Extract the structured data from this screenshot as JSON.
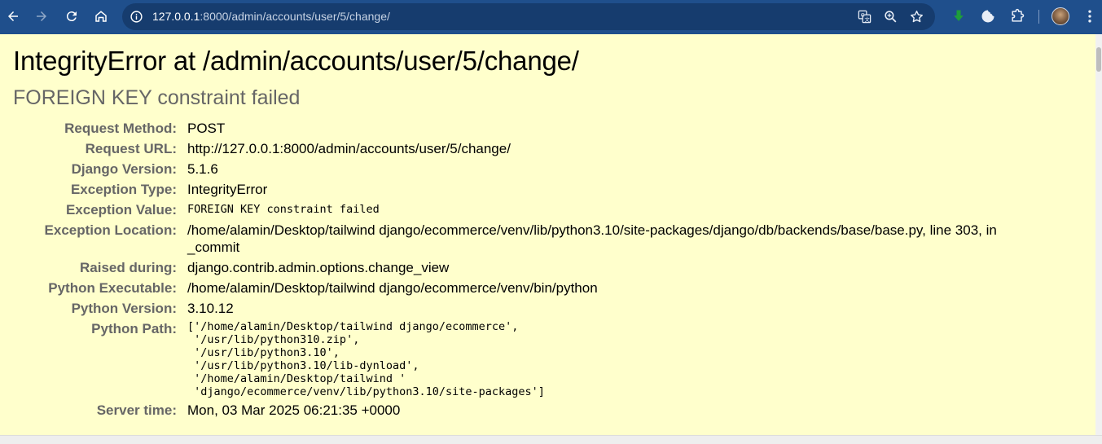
{
  "browser": {
    "url_host": "127.0.0.1",
    "url_rest": ":8000/admin/accounts/user/5/change/",
    "colors": {
      "toolbar": "#1f4f8c",
      "omnibox": "#163c6e"
    },
    "icons": [
      "back-icon",
      "forward-icon",
      "reload-icon",
      "home-icon",
      "site-info-icon",
      "translate-icon",
      "zoom-icon",
      "bookmark-star-icon",
      "download-extension-icon",
      "cookie-extension-icon",
      "extensions-puzzle-icon",
      "menu-kebab-icon"
    ]
  },
  "page": {
    "title": "IntegrityError at /admin/accounts/user/5/change/",
    "subtitle": "FOREIGN KEY constraint failed",
    "background": "#ffffcc",
    "meta": [
      {
        "label": "Request Method:",
        "value": "POST"
      },
      {
        "label": "Request URL:",
        "value": "http://127.0.0.1:8000/admin/accounts/user/5/change/"
      },
      {
        "label": "Django Version:",
        "value": "5.1.6"
      },
      {
        "label": "Exception Type:",
        "value": "IntegrityError"
      },
      {
        "label": "Exception Value:",
        "value": "FOREIGN KEY constraint failed"
      },
      {
        "label": "Exception Location:",
        "value": "/home/alamin/Desktop/tailwind django/ecommerce/venv/lib/python3.10/site-packages/django/db/backends/base/base.py, line 303, in _commit"
      },
      {
        "label": "Raised during:",
        "value": "django.contrib.admin.options.change_view"
      },
      {
        "label": "Python Executable:",
        "value": "/home/alamin/Desktop/tailwind django/ecommerce/venv/bin/python"
      },
      {
        "label": "Python Version:",
        "value": "3.10.12"
      },
      {
        "label": "Python Path:",
        "value": "['/home/alamin/Desktop/tailwind django/ecommerce',\n '/usr/lib/python310.zip',\n '/usr/lib/python3.10',\n '/usr/lib/python3.10/lib-dynload',\n '/home/alamin/Desktop/tailwind '\n 'django/ecommerce/venv/lib/python3.10/site-packages']"
      },
      {
        "label": "Server time:",
        "value": "Mon, 03 Mar 2025 06:21:35 +0000"
      }
    ]
  }
}
